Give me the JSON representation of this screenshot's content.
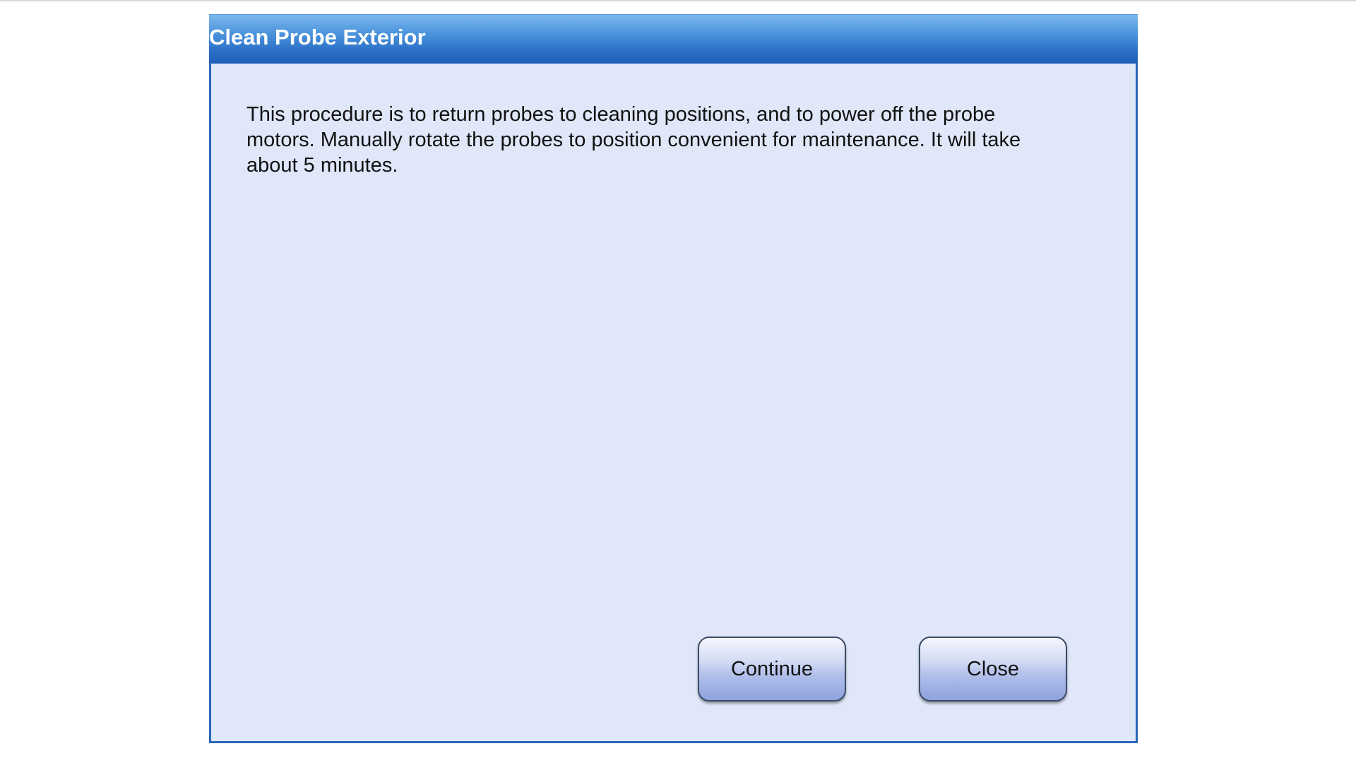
{
  "dialog": {
    "title": "Clean Probe Exterior",
    "message": "This procedure is to return probes to cleaning positions, and to power off the probe motors. Manually rotate the probes to position convenient for maintenance. It will take about 5 minutes.",
    "buttons": {
      "continue_label": "Continue",
      "close_label": "Close"
    }
  },
  "colors": {
    "titlebar": "#2a6fc7",
    "dialog_background": "#dfe7f8",
    "border": "#2a66b8",
    "button": "#aebde9"
  }
}
